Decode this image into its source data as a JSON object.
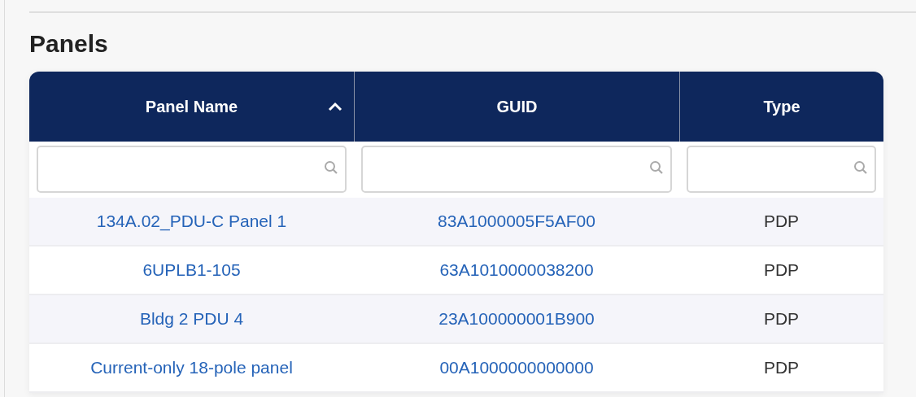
{
  "title": "Panels",
  "table": {
    "columns": [
      {
        "label": "Panel Name",
        "kind": "link",
        "sorted": true
      },
      {
        "label": "GUID",
        "kind": "link",
        "sorted": false
      },
      {
        "label": "Type",
        "kind": "text",
        "sorted": false
      }
    ],
    "rows": [
      [
        "134A.02_PDU-C Panel 1",
        "83A1000005F5AF00",
        "PDP"
      ],
      [
        "6UPLB1-105",
        "63A1010000038200",
        "PDP"
      ],
      [
        "Bldg 2 PDU 4",
        "23A100000001B900",
        "PDP"
      ],
      [
        "Current-only 18-pole panel",
        "00A1000000000000",
        "PDP"
      ]
    ]
  }
}
